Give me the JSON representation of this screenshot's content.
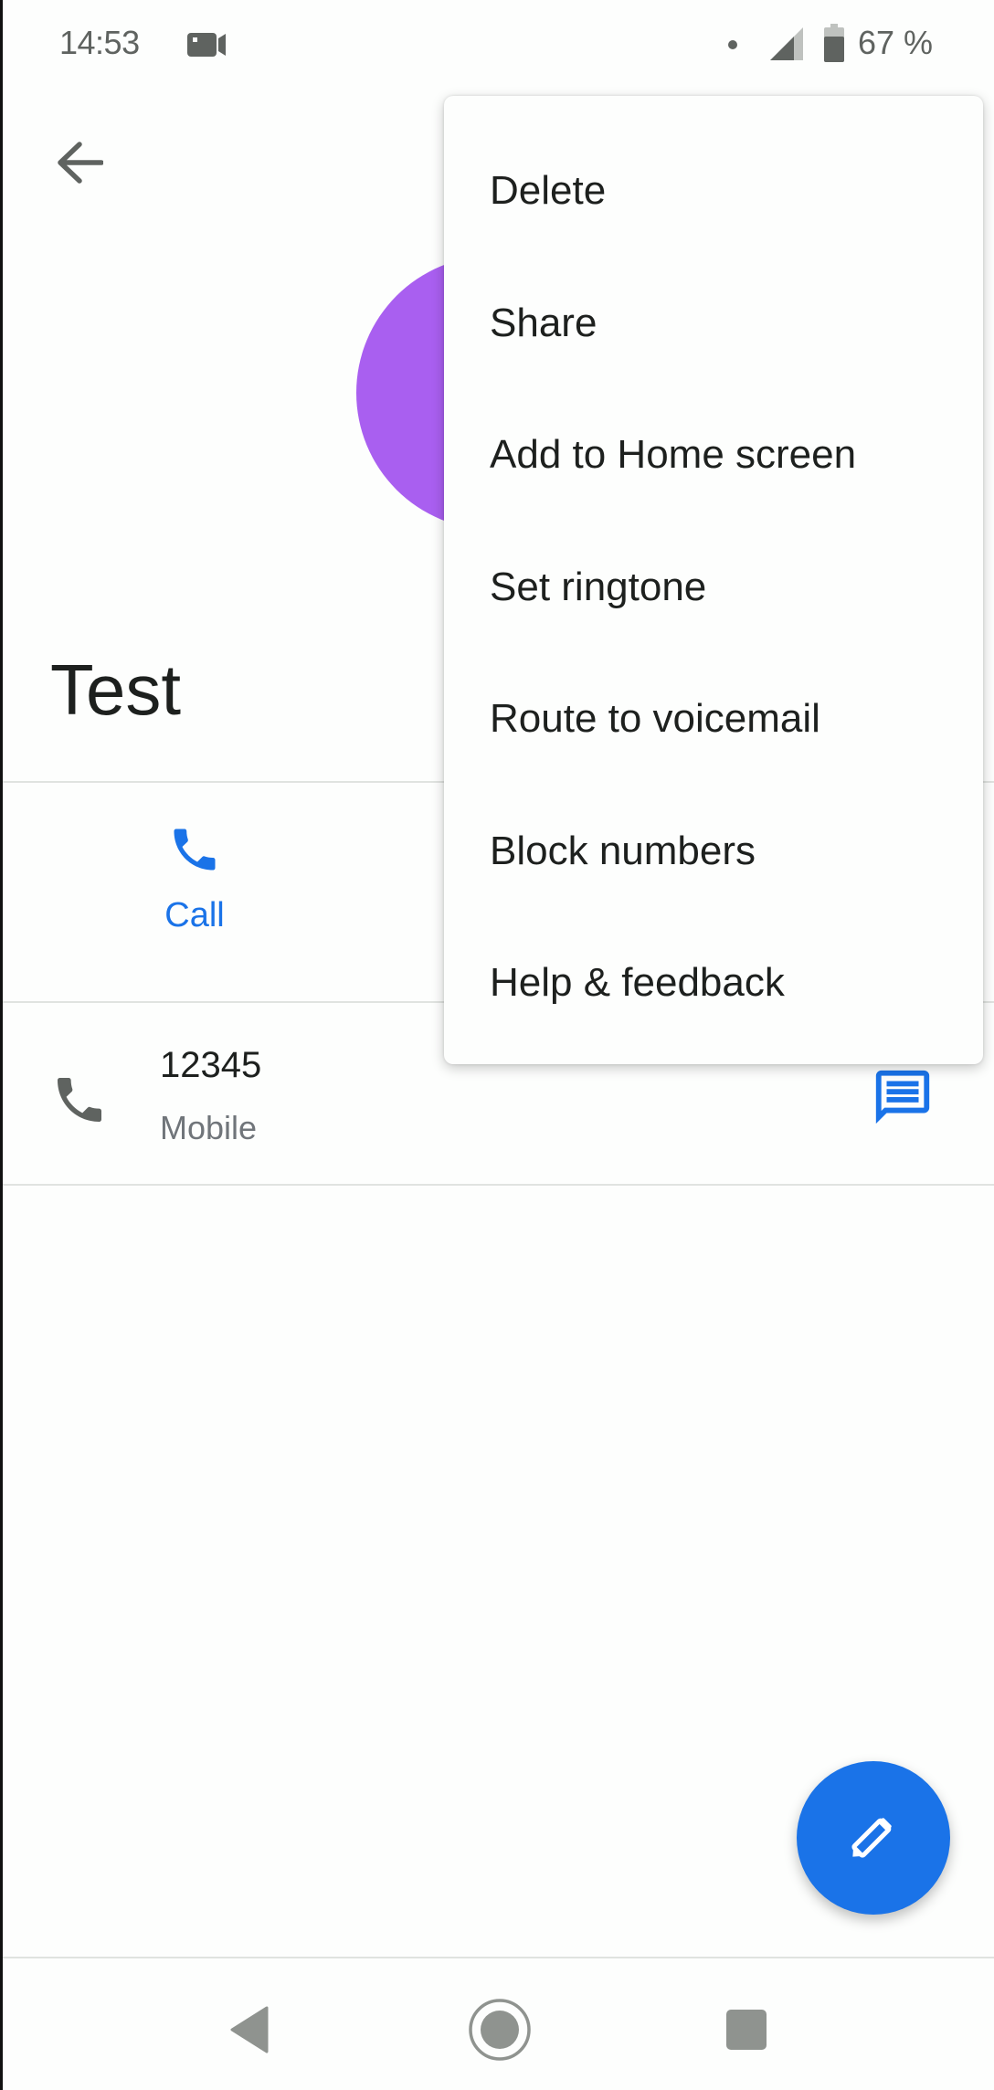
{
  "status_bar": {
    "time": "14:53",
    "battery": "67 %",
    "icons": [
      "video-camera-icon",
      "notification-dot",
      "cell-signal-icon",
      "battery-icon"
    ]
  },
  "header": {
    "back_icon": "arrow-left-icon"
  },
  "contact": {
    "name": "Test",
    "avatar_color": "#a95ff0"
  },
  "actions": {
    "call_label": "Call",
    "accent": "#1a73e8"
  },
  "phone": {
    "number": "12345",
    "type": "Mobile"
  },
  "menu": {
    "items": [
      {
        "label": "Delete"
      },
      {
        "label": "Share"
      },
      {
        "label": "Add to Home screen"
      },
      {
        "label": "Set ringtone"
      },
      {
        "label": "Route to voicemail"
      },
      {
        "label": "Block numbers"
      },
      {
        "label": "Help & feedback"
      }
    ]
  },
  "fab": {
    "icon": "pencil-icon",
    "color": "#1a73e8"
  },
  "nav": {
    "icons": [
      "nav-back-icon",
      "nav-home-icon",
      "nav-recents-icon"
    ]
  }
}
